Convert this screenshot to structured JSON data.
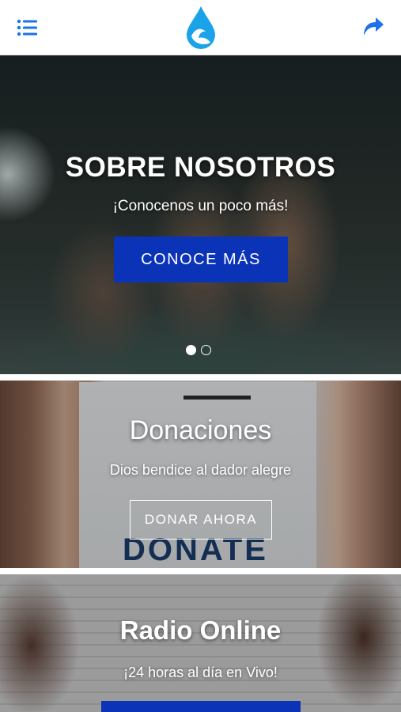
{
  "colors": {
    "brand_blue": "#1a73e8",
    "button_blue": "#0b33b8",
    "text_on_image": "#ffffff"
  },
  "header": {
    "menu_icon": "hamburger-menu-icon",
    "logo_icon": "water-drop-logo-icon",
    "share_icon": "share-arrow-icon"
  },
  "hero": {
    "title": "SOBRE NOSOTROS",
    "subtitle": "¡Conocenos un poco más!",
    "button_label": "CONOCE MÁS",
    "carousel_active_index": 0,
    "carousel_count": 2
  },
  "donations": {
    "title": "Donaciones",
    "subtitle": "Dios bendice al dador alegre",
    "button_label": "DONAR AHORA",
    "image_text": "DONATE"
  },
  "radio": {
    "title": "Radio Online",
    "subtitle": "¡24 horas al día en Vivo!"
  }
}
